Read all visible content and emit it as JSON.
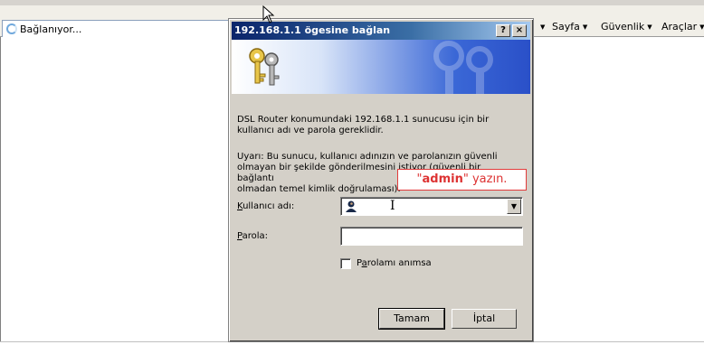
{
  "browser": {
    "tab_status": "Bağlanıyor...",
    "menu": {
      "page": "Sayfa",
      "security": "Güvenlik",
      "tools": "Araçlar"
    }
  },
  "dialog": {
    "title": "192.168.1.1 ögesine bağlan",
    "help_button": "?",
    "close_button": "×",
    "message_line1": "DSL Router konumundaki 192.168.1.1 sunucusu için bir",
    "message_line2": "kullanıcı adı ve parola gereklidir.",
    "warning_line1": "Uyarı: Bu sunucu, kullanıcı adınızın ve parolanızın güvenli",
    "warning_line2": "olmayan bir şekilde gönderilmesini istiyor (güvenli bir bağlantı",
    "warning_line3": "olmadan temel kimlik doğrulaması).",
    "username_label_underlined": "K",
    "username_label_rest": "ullanıcı adı:",
    "username_value": "",
    "password_label_underlined": "P",
    "password_label_rest": "arola:",
    "password_value": "",
    "remember_label_prefix": "P",
    "remember_label_underlined": "a",
    "remember_label_rest": "rolamı anımsa",
    "remember_checked": false,
    "ok_button": "Tamam",
    "cancel_button": "İptal"
  },
  "annotation": {
    "quote_open": "\"",
    "highlight": "admin",
    "rest": "\" yazın."
  },
  "colors": {
    "title_gradient_start": "#0a246a",
    "callout_red": "#d33333",
    "dialog_face": "#d4d0c8"
  },
  "icons": {
    "tab": "loading-spinner-icon",
    "banner": "keys-icon",
    "combo": "user-icon"
  }
}
